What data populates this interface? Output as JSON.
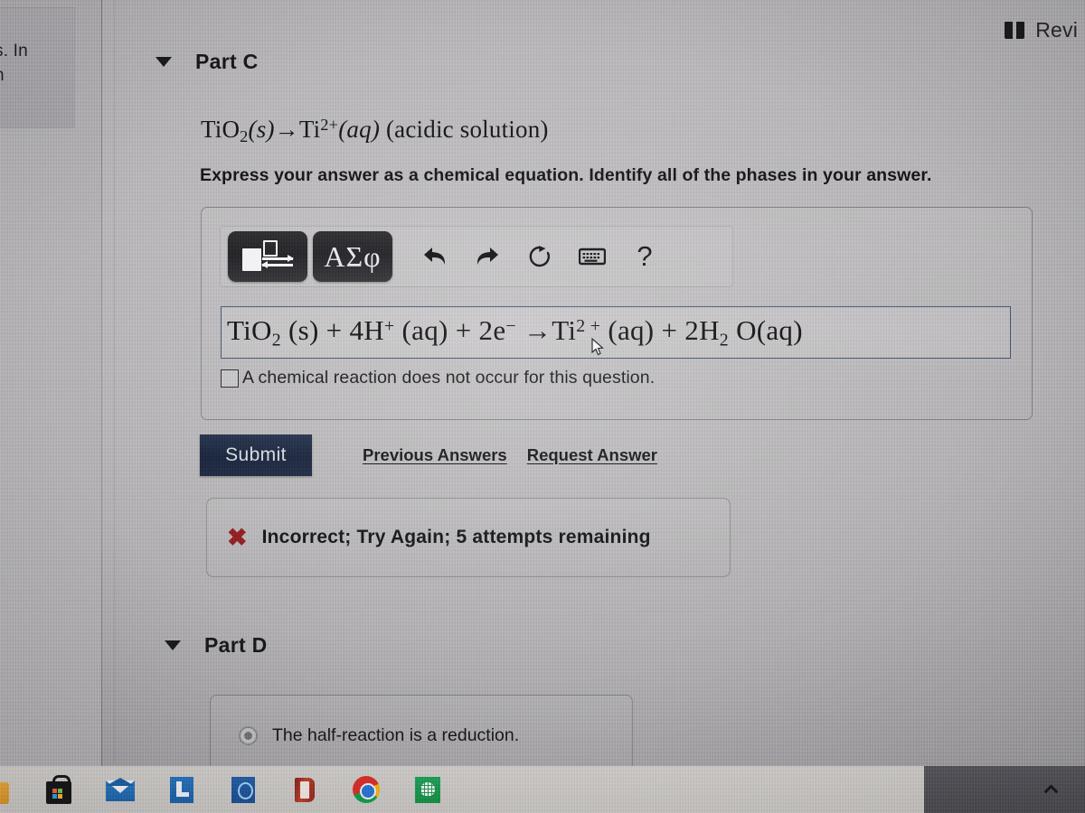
{
  "window": {
    "review_label": "Revi",
    "review_icon": "book-icon",
    "sidebar_partial_text": "s. In\nn"
  },
  "part_c": {
    "caret_icon": "caret-down-icon",
    "title": "Part C",
    "prompt_equation_plain": "TiO2(s)→Ti2+(aq) (acidic solution)",
    "prompt": {
      "formula_a": "TiO",
      "formula_a_sub": "2",
      "phase_a": "(s)",
      "arrow": "→",
      "formula_b": "Ti",
      "formula_b_sup": "2+",
      "phase_b": "(aq)",
      "note": "(acidic solution)"
    },
    "instruction": "Express your answer as a chemical equation. Identify all of the phases in your answer.",
    "toolbar": {
      "template_button": "chemistry-template",
      "greek_button": "ΑΣφ",
      "undo": "undo-arrow",
      "redo": "redo-arrow",
      "reset": "reset-arrow",
      "keyboard": "keyboard",
      "help": "?"
    },
    "answer": {
      "equation_plain": "TiO2 (s) + 4H+ (aq) + 2e- →Ti2+ (aq) + 2H2 O(aq)",
      "tokens": [
        {
          "t": "TiO",
          "sub": "2"
        },
        {
          "t": " (s) + 4H",
          "sup": "+"
        },
        {
          "t": " (aq) + 2e",
          "sup": "−"
        },
        {
          "t": " →Ti",
          "sup": "2 +"
        },
        {
          "t": " (aq) + 2H",
          "sub": "2"
        },
        {
          "t": " O(aq)"
        }
      ]
    },
    "no_reaction_checkbox": {
      "label": "A chemical reaction does not occur for this question.",
      "checked": false
    },
    "submit_label": "Submit",
    "previous_answers_label": "Previous Answers",
    "request_answer_label": "Request Answer",
    "feedback": {
      "icon": "x-mark",
      "text": "Incorrect; Try Again; 5 attempts remaining",
      "color": "#8e1d20"
    }
  },
  "part_d": {
    "caret_icon": "caret-down-icon",
    "title": "Part D",
    "options": [
      {
        "label": "The half-reaction is a reduction.",
        "selected": true
      }
    ]
  },
  "taskbar": {
    "apps": [
      "microsoft-store",
      "mail",
      "linkedin-l",
      "cortana",
      "office",
      "chrome",
      "excel"
    ],
    "tray_chevron": "show-hidden-icons"
  },
  "colors": {
    "page_background": "#b4b2b4",
    "submit_button": "#1b2a42",
    "equation_border": "#43536e",
    "error_red": "#8e1d20",
    "taskbar": "#cbc8c5"
  }
}
